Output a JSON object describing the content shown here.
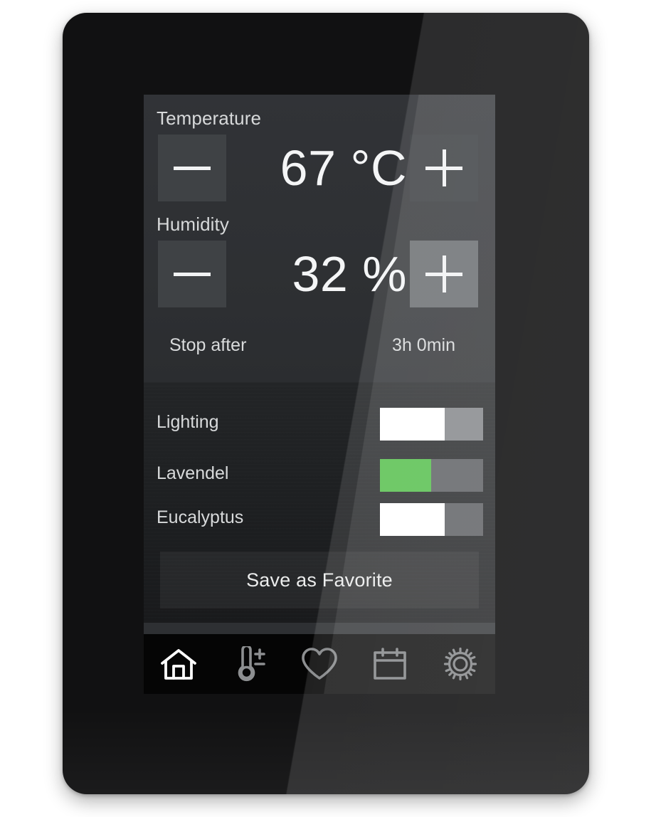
{
  "device": {
    "name": "wall-mounted climate touch panel",
    "bezel_color": "#111112",
    "screen_bg": "#2e3033"
  },
  "screen": {
    "temperature": {
      "label": "Temperature",
      "value": "67 °C",
      "decrease_glyph": "−",
      "increase_glyph": "+",
      "decrease_name": "minus-icon",
      "increase_name": "plus-icon"
    },
    "humidity": {
      "label": "Humidity",
      "value": "32 %",
      "decrease_glyph": "−",
      "increase_glyph": "+",
      "decrease_name": "minus-icon",
      "increase_name": "plus-icon"
    },
    "stop_after": {
      "label": "Stop after",
      "value": "3h 0min"
    },
    "toggles": [
      {
        "label": "Lighting",
        "state": "on",
        "thumb_color": "#ffffff",
        "track_color": "#8e9093"
      },
      {
        "label": "Lavendel",
        "state": "on",
        "thumb_color": "#62c45a",
        "track_color": "#6b6d70"
      },
      {
        "label": "Eucalyptus",
        "state": "on",
        "thumb_color": "#ffffff",
        "track_color": "#6b6d70"
      }
    ],
    "save_favorite": {
      "label": "Save as Favorite"
    },
    "navbar": {
      "items": [
        {
          "icon": "home-icon",
          "label": "Home",
          "active": true
        },
        {
          "icon": "thermometer-icon",
          "label": "Climate",
          "active": false
        },
        {
          "icon": "heart-icon",
          "label": "Favorite",
          "active": false
        },
        {
          "icon": "calendar-icon",
          "label": "Schedule",
          "active": false
        },
        {
          "icon": "gear-icon",
          "label": "Settings",
          "active": false
        }
      ]
    }
  },
  "colors": {
    "accent_green": "#62c45a",
    "thumb_on": "#ffffff",
    "text_primary": "#f4f5f6",
    "text_secondary": "#d8dadb",
    "button_minus": "#3f4245",
    "button_plus": "#4a4d50",
    "button_plus_bright": "#75787b"
  }
}
